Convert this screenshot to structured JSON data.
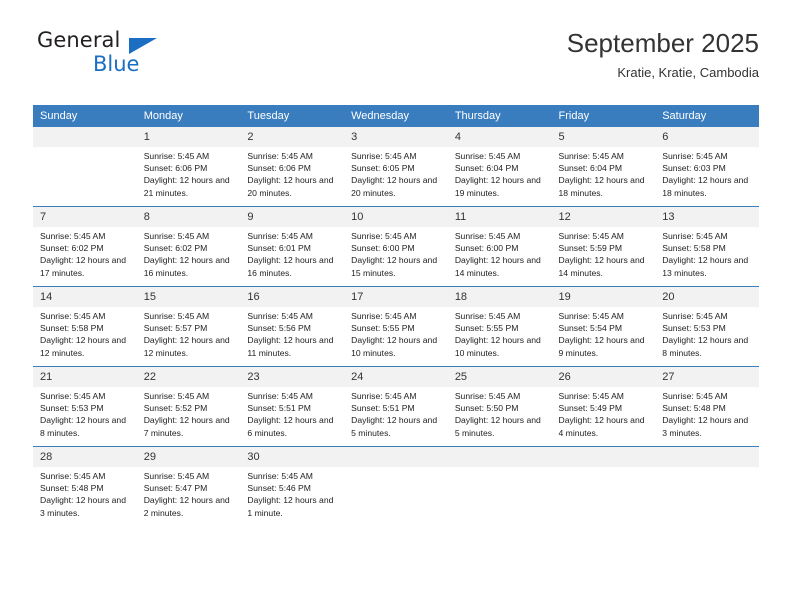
{
  "brand": {
    "name_part1": "General",
    "name_part2": "Blue",
    "triangle_color": "#1b6ec2"
  },
  "header": {
    "title": "September 2025",
    "subtitle": "Kratie, Kratie, Cambodia"
  },
  "theme": {
    "header_bg": "#3a7dbf",
    "daynum_bg": "#f2f2f2",
    "rule_color": "#3a7dbf"
  },
  "weekdays": [
    "Sunday",
    "Monday",
    "Tuesday",
    "Wednesday",
    "Thursday",
    "Friday",
    "Saturday"
  ],
  "weeks": [
    [
      {
        "day": "",
        "sunrise": "",
        "sunset": "",
        "daylight": ""
      },
      {
        "day": "1",
        "sunrise": "Sunrise: 5:45 AM",
        "sunset": "Sunset: 6:06 PM",
        "daylight": "Daylight: 12 hours and 21 minutes."
      },
      {
        "day": "2",
        "sunrise": "Sunrise: 5:45 AM",
        "sunset": "Sunset: 6:06 PM",
        "daylight": "Daylight: 12 hours and 20 minutes."
      },
      {
        "day": "3",
        "sunrise": "Sunrise: 5:45 AM",
        "sunset": "Sunset: 6:05 PM",
        "daylight": "Daylight: 12 hours and 20 minutes."
      },
      {
        "day": "4",
        "sunrise": "Sunrise: 5:45 AM",
        "sunset": "Sunset: 6:04 PM",
        "daylight": "Daylight: 12 hours and 19 minutes."
      },
      {
        "day": "5",
        "sunrise": "Sunrise: 5:45 AM",
        "sunset": "Sunset: 6:04 PM",
        "daylight": "Daylight: 12 hours and 18 minutes."
      },
      {
        "day": "6",
        "sunrise": "Sunrise: 5:45 AM",
        "sunset": "Sunset: 6:03 PM",
        "daylight": "Daylight: 12 hours and 18 minutes."
      }
    ],
    [
      {
        "day": "7",
        "sunrise": "Sunrise: 5:45 AM",
        "sunset": "Sunset: 6:02 PM",
        "daylight": "Daylight: 12 hours and 17 minutes."
      },
      {
        "day": "8",
        "sunrise": "Sunrise: 5:45 AM",
        "sunset": "Sunset: 6:02 PM",
        "daylight": "Daylight: 12 hours and 16 minutes."
      },
      {
        "day": "9",
        "sunrise": "Sunrise: 5:45 AM",
        "sunset": "Sunset: 6:01 PM",
        "daylight": "Daylight: 12 hours and 16 minutes."
      },
      {
        "day": "10",
        "sunrise": "Sunrise: 5:45 AM",
        "sunset": "Sunset: 6:00 PM",
        "daylight": "Daylight: 12 hours and 15 minutes."
      },
      {
        "day": "11",
        "sunrise": "Sunrise: 5:45 AM",
        "sunset": "Sunset: 6:00 PM",
        "daylight": "Daylight: 12 hours and 14 minutes."
      },
      {
        "day": "12",
        "sunrise": "Sunrise: 5:45 AM",
        "sunset": "Sunset: 5:59 PM",
        "daylight": "Daylight: 12 hours and 14 minutes."
      },
      {
        "day": "13",
        "sunrise": "Sunrise: 5:45 AM",
        "sunset": "Sunset: 5:58 PM",
        "daylight": "Daylight: 12 hours and 13 minutes."
      }
    ],
    [
      {
        "day": "14",
        "sunrise": "Sunrise: 5:45 AM",
        "sunset": "Sunset: 5:58 PM",
        "daylight": "Daylight: 12 hours and 12 minutes."
      },
      {
        "day": "15",
        "sunrise": "Sunrise: 5:45 AM",
        "sunset": "Sunset: 5:57 PM",
        "daylight": "Daylight: 12 hours and 12 minutes."
      },
      {
        "day": "16",
        "sunrise": "Sunrise: 5:45 AM",
        "sunset": "Sunset: 5:56 PM",
        "daylight": "Daylight: 12 hours and 11 minutes."
      },
      {
        "day": "17",
        "sunrise": "Sunrise: 5:45 AM",
        "sunset": "Sunset: 5:55 PM",
        "daylight": "Daylight: 12 hours and 10 minutes."
      },
      {
        "day": "18",
        "sunrise": "Sunrise: 5:45 AM",
        "sunset": "Sunset: 5:55 PM",
        "daylight": "Daylight: 12 hours and 10 minutes."
      },
      {
        "day": "19",
        "sunrise": "Sunrise: 5:45 AM",
        "sunset": "Sunset: 5:54 PM",
        "daylight": "Daylight: 12 hours and 9 minutes."
      },
      {
        "day": "20",
        "sunrise": "Sunrise: 5:45 AM",
        "sunset": "Sunset: 5:53 PM",
        "daylight": "Daylight: 12 hours and 8 minutes."
      }
    ],
    [
      {
        "day": "21",
        "sunrise": "Sunrise: 5:45 AM",
        "sunset": "Sunset: 5:53 PM",
        "daylight": "Daylight: 12 hours and 8 minutes."
      },
      {
        "day": "22",
        "sunrise": "Sunrise: 5:45 AM",
        "sunset": "Sunset: 5:52 PM",
        "daylight": "Daylight: 12 hours and 7 minutes."
      },
      {
        "day": "23",
        "sunrise": "Sunrise: 5:45 AM",
        "sunset": "Sunset: 5:51 PM",
        "daylight": "Daylight: 12 hours and 6 minutes."
      },
      {
        "day": "24",
        "sunrise": "Sunrise: 5:45 AM",
        "sunset": "Sunset: 5:51 PM",
        "daylight": "Daylight: 12 hours and 5 minutes."
      },
      {
        "day": "25",
        "sunrise": "Sunrise: 5:45 AM",
        "sunset": "Sunset: 5:50 PM",
        "daylight": "Daylight: 12 hours and 5 minutes."
      },
      {
        "day": "26",
        "sunrise": "Sunrise: 5:45 AM",
        "sunset": "Sunset: 5:49 PM",
        "daylight": "Daylight: 12 hours and 4 minutes."
      },
      {
        "day": "27",
        "sunrise": "Sunrise: 5:45 AM",
        "sunset": "Sunset: 5:48 PM",
        "daylight": "Daylight: 12 hours and 3 minutes."
      }
    ],
    [
      {
        "day": "28",
        "sunrise": "Sunrise: 5:45 AM",
        "sunset": "Sunset: 5:48 PM",
        "daylight": "Daylight: 12 hours and 3 minutes."
      },
      {
        "day": "29",
        "sunrise": "Sunrise: 5:45 AM",
        "sunset": "Sunset: 5:47 PM",
        "daylight": "Daylight: 12 hours and 2 minutes."
      },
      {
        "day": "30",
        "sunrise": "Sunrise: 5:45 AM",
        "sunset": "Sunset: 5:46 PM",
        "daylight": "Daylight: 12 hours and 1 minute."
      },
      {
        "day": "",
        "sunrise": "",
        "sunset": "",
        "daylight": ""
      },
      {
        "day": "",
        "sunrise": "",
        "sunset": "",
        "daylight": ""
      },
      {
        "day": "",
        "sunrise": "",
        "sunset": "",
        "daylight": ""
      },
      {
        "day": "",
        "sunrise": "",
        "sunset": "",
        "daylight": ""
      }
    ]
  ]
}
